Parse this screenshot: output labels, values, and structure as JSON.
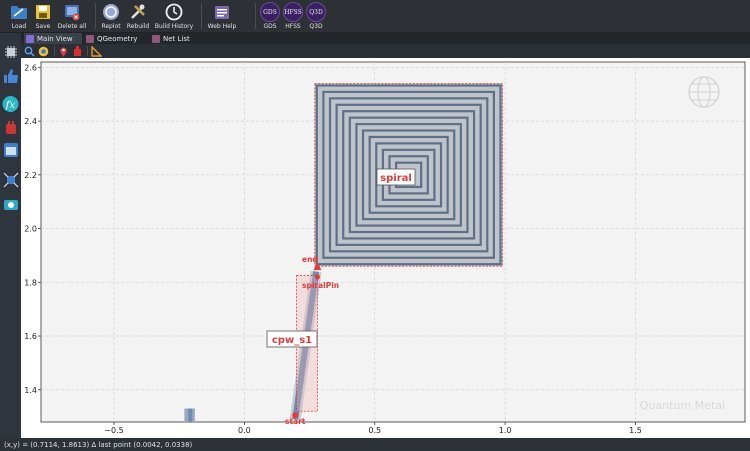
{
  "toolbar": {
    "buttons": [
      {
        "label": "Load",
        "icon": "folder-icon"
      },
      {
        "label": "Save",
        "icon": "floppy-disk-icon"
      },
      {
        "label": "Delete all",
        "icon": "delete-all-icon"
      },
      {
        "label": "Replot",
        "icon": "replot-icon"
      },
      {
        "label": "Rebuild",
        "icon": "tools-icon"
      },
      {
        "label": "Build History",
        "icon": "history-clock-icon"
      },
      {
        "label": "Web Help",
        "icon": "web-help-icon"
      },
      {
        "label": "GDS",
        "icon": "gds-icon",
        "badge": "GDS"
      },
      {
        "label": "HFSS",
        "icon": "hfss-icon",
        "badge": "HFSS"
      },
      {
        "label": "Q3D",
        "icon": "q3d-icon",
        "badge": "Q3D"
      }
    ]
  },
  "tabs": [
    {
      "label": "Main View",
      "active": true
    },
    {
      "label": "QGeometry",
      "active": false
    },
    {
      "label": "Net List",
      "active": false
    }
  ],
  "status": {
    "coords": "(x,y) = (0.7114, 1.8613)  Δ last point (0.0042, 0.0338)"
  },
  "plot": {
    "watermark": "Quantum Metal",
    "x_ticks": [
      "−0.5",
      "0.0",
      "0.5",
      "1.0",
      "1.5"
    ],
    "y_ticks": [
      "1.4",
      "1.6",
      "1.8",
      "2.0",
      "2.2",
      "2.4",
      "2.6"
    ],
    "components": [
      {
        "name": "spiral",
        "label": "spiral"
      },
      {
        "name": "cpw_s1",
        "label": "cpw_s1"
      }
    ],
    "pins": [
      {
        "label": "end"
      },
      {
        "label": "spiralPin"
      },
      {
        "label": "start"
      }
    ]
  },
  "colors": {
    "spiral_trace": "#5f6f86",
    "cpw_fill": "#6e8bb0",
    "pin_red": "#e23b3b",
    "bbox_red": "#e23b3b",
    "plot_bg": "#f3f3f3"
  },
  "chart_data": {
    "type": "scatter",
    "xlim": [
      -0.78,
      1.92
    ],
    "ylim": [
      1.28,
      2.62
    ],
    "xticks": [
      -0.5,
      0.0,
      0.5,
      1.0,
      1.5
    ],
    "yticks": [
      1.4,
      1.6,
      1.8,
      2.0,
      2.2,
      2.4,
      2.6
    ],
    "grid": true,
    "spiral_bounds": {
      "x": [
        0.27,
        0.99
      ],
      "y": [
        1.86,
        2.54
      ]
    },
    "cpw_path": [
      [
        0.195,
        1.29
      ],
      [
        0.275,
        1.84
      ]
    ],
    "pin_points": {
      "end": [
        0.28,
        1.86
      ],
      "spiralPin": [
        0.28,
        1.82
      ],
      "start": [
        0.195,
        1.305
      ]
    },
    "stub": {
      "x": [
        -0.23,
        -0.19
      ],
      "y": [
        1.28,
        1.33
      ]
    }
  }
}
